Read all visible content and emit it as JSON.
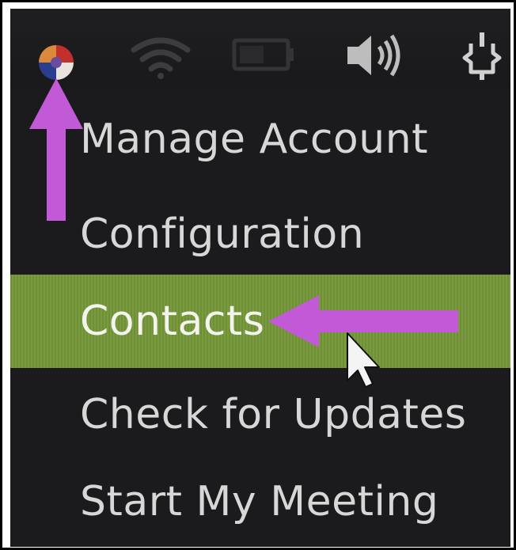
{
  "panel": {
    "icons": [
      "app-indicator-icon",
      "wifi-icon",
      "battery-icon",
      "volume-icon",
      "power-icon"
    ]
  },
  "menu": {
    "items": [
      {
        "label": "Manage Account",
        "highlighted": false
      },
      {
        "label": "Configuration",
        "highlighted": false
      },
      {
        "label": "Contacts",
        "highlighted": true
      },
      {
        "label": "Check for Updates",
        "highlighted": false
      },
      {
        "label": "Start My Meeting",
        "highlighted": false
      }
    ]
  },
  "colors": {
    "highlight": "#7a9b40",
    "annotation_arrow": "#c259d6",
    "panel_background": "#1b1b1d",
    "menu_text": "#d7d7d7"
  },
  "annotations": {
    "arrows": [
      "up-arrow-to-app-indicator",
      "left-arrow-to-contacts"
    ]
  }
}
